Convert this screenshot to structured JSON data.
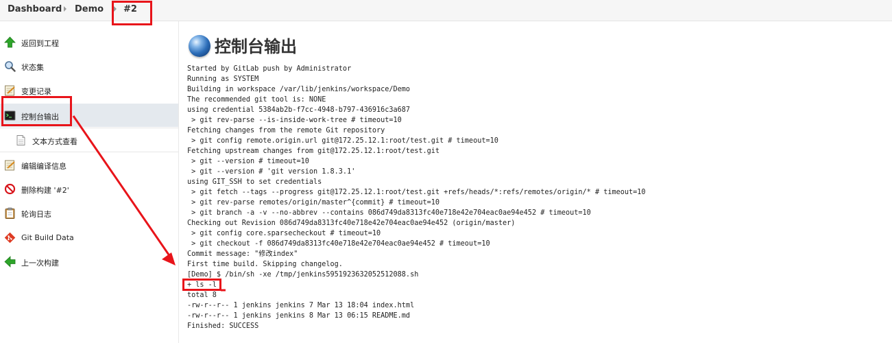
{
  "breadcrumb": {
    "items": [
      "Dashboard",
      "Demo",
      "#2"
    ]
  },
  "sidebar": {
    "items": [
      {
        "label": "返回到工程",
        "icon": "up-arrow-icon"
      },
      {
        "label": "状态集",
        "icon": "search-icon"
      },
      {
        "label": "变更记录",
        "icon": "notepad-icon"
      },
      {
        "label": "控制台输出",
        "icon": "terminal-icon"
      },
      {
        "label": "文本方式查看",
        "icon": "document-icon"
      },
      {
        "label": "编辑编译信息",
        "icon": "notepad-icon"
      },
      {
        "label": "删除构建 '#2'",
        "icon": "no-entry-icon"
      },
      {
        "label": "轮询日志",
        "icon": "clipboard-icon"
      },
      {
        "label": "Git Build Data",
        "icon": "git-icon"
      },
      {
        "label": "上一次构建",
        "icon": "left-arrow-icon"
      }
    ]
  },
  "main": {
    "title": "控制台输出",
    "console_lines": [
      "Started by GitLab push by Administrator",
      "Running as SYSTEM",
      "Building in workspace /var/lib/jenkins/workspace/Demo",
      "The recommended git tool is: NONE",
      "using credential 5384ab2b-f7cc-4948-b797-436916c3a687",
      " > git rev-parse --is-inside-work-tree # timeout=10",
      "Fetching changes from the remote Git repository",
      " > git config remote.origin.url git@172.25.12.1:root/test.git # timeout=10",
      "Fetching upstream changes from git@172.25.12.1:root/test.git",
      " > git --version # timeout=10",
      " > git --version # 'git version 1.8.3.1'",
      "using GIT_SSH to set credentials",
      " > git fetch --tags --progress git@172.25.12.1:root/test.git +refs/heads/*:refs/remotes/origin/* # timeout=10",
      " > git rev-parse remotes/origin/master^{commit} # timeout=10",
      " > git branch -a -v --no-abbrev --contains 086d749da8313fc40e718e42e704eac0ae94e452 # timeout=10",
      "Checking out Revision 086d749da8313fc40e718e42e704eac0ae94e452 (origin/master)",
      " > git config core.sparsecheckout # timeout=10",
      " > git checkout -f 086d749da8313fc40e718e42e704eac0ae94e452 # timeout=10",
      "Commit message: \"修改index\"",
      "First time build. Skipping changelog.",
      "[Demo] $ /bin/sh -xe /tmp/jenkins5951923632052512088.sh",
      "+ ls -l",
      "total 8",
      "-rw-r--r-- 1 jenkins jenkins 7 Mar 13 18:04 index.html",
      "-rw-r--r-- 1 jenkins jenkins 8 Mar 13 06:15 README.md",
      "Finished: SUCCESS"
    ]
  },
  "colors": {
    "annotation": "#e8141a",
    "active_row": "#e4e9ee"
  }
}
